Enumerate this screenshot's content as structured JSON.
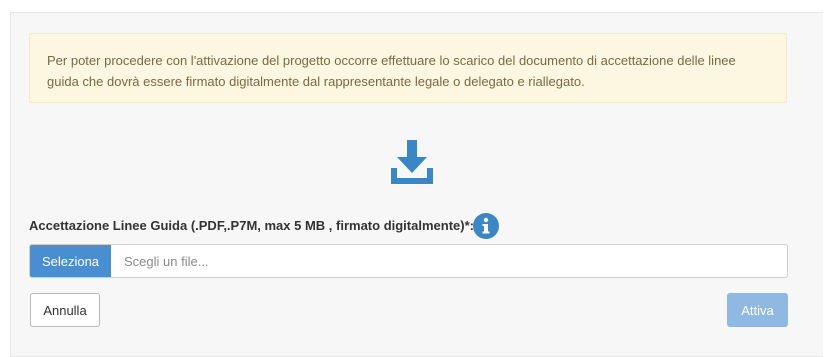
{
  "alert": {
    "line1": "Per poter procedere con l'attivazione del progetto occorre effettuare lo scarico del documento di accettazione delle linee",
    "line2": "guida che dovrà essere firmato digitalmente dal rappresentante legale o delegato e riallegato."
  },
  "download": {
    "icon": "download-icon",
    "color": "#3a87c8"
  },
  "upload_field": {
    "label": "Accettazione Linee Guida (.PDF,.P7M, max 5 MB , firmato digitalmente)*:",
    "info_icon": "info-circle-icon",
    "select_label": "Seleziona",
    "placeholder": "Scegli un file..."
  },
  "actions": {
    "cancel_label": "Annulla",
    "activate_label": "Attiva",
    "activate_disabled": true
  },
  "colors": {
    "primary": "#4a8ed2",
    "primary_disabled": "#8fb8e2",
    "alert_bg": "#fdf6e0",
    "alert_text": "#7a6a45"
  }
}
